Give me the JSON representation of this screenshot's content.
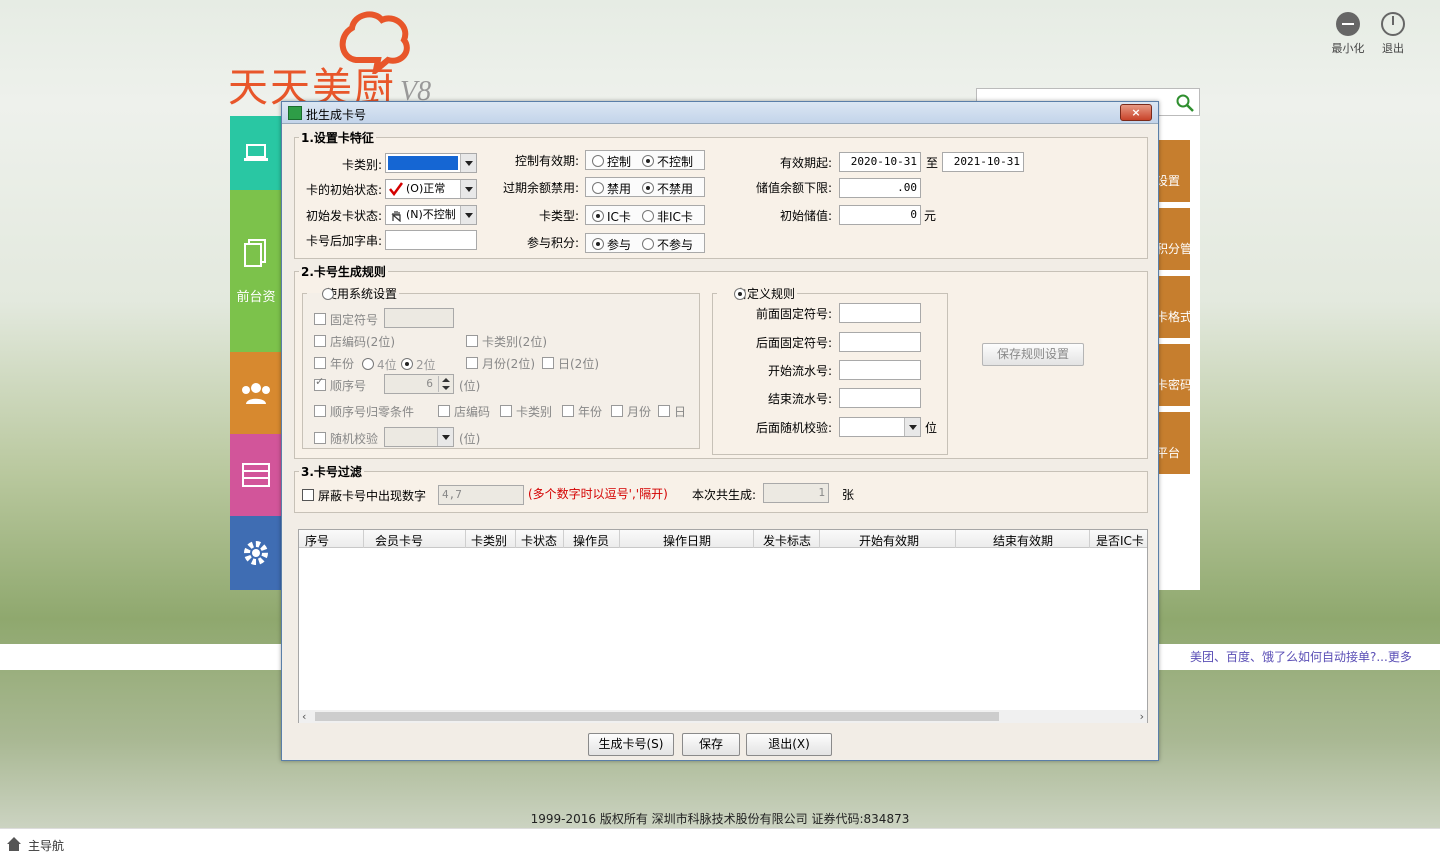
{
  "app": {
    "logo_text": "天天美厨",
    "logo_version": "V8",
    "minimize_label": "最小化",
    "exit_label": "退出",
    "front_label": "前台资",
    "right_tiles": [
      "设置",
      "积分管",
      "卡格式",
      "卡密码",
      "平台"
    ],
    "news_text": "美团、百度、饿了么如何自动接单?...更多",
    "copyright": "1999-2016  版权所有  深圳市科脉技术股份有限公司  证券代码:834873",
    "nav_label": "主导航"
  },
  "dialog": {
    "title": "批生成卡号",
    "close": "×",
    "sec1": {
      "legend": "1.设置卡特征",
      "card_type_label": "卡类别:",
      "init_status_label": "卡的初始状态:",
      "init_status_value": "(O)正常",
      "issue_status_label": "初始发卡状态:",
      "issue_status_value": "(N)不控制",
      "suffix_label": "卡号后加字串:",
      "validity_ctrl_label": "控制有效期:",
      "opt_control": "控制",
      "opt_no_control": "不控制",
      "expired_label": "过期余额禁用:",
      "opt_disable": "禁用",
      "opt_no_disable": "不禁用",
      "card_kind_label": "卡类型:",
      "opt_ic": "IC卡",
      "opt_non_ic": "非IC卡",
      "points_label": "参与积分:",
      "opt_join": "参与",
      "opt_no_join": "不参与",
      "valid_from_label": "有效期起:",
      "valid_from": "2020-10-31",
      "to_label": "至",
      "valid_to": "2021-10-31",
      "balance_min_label": "储值余额下限:",
      "balance_min": ".00",
      "init_value_label": "初始储值:",
      "init_value": "0",
      "yuan": "元"
    },
    "sec2": {
      "legend": "2.卡号生成规则",
      "sys_legend": "使用系统设置",
      "fixed_char": "固定符号",
      "store_code": "店编码(2位)",
      "card_cat": "卡类别(2位)",
      "year": "年份",
      "four": "4位",
      "two": "2位",
      "month": "月份(2位)",
      "day": "日(2位)",
      "seq": "顺序号",
      "seq_value": "6",
      "wei": "(位)",
      "seq_reset": "顺序号归零条件",
      "r_store": "店编码",
      "r_card": "卡类别",
      "r_year": "年份",
      "r_month": "月份",
      "r_day": "日",
      "random": "随机校验",
      "custom_legend": "自定义规则",
      "prefix_label": "前面固定符号:",
      "postfix_label": "后面固定符号:",
      "start_label": "开始流水号:",
      "end_label": "结束流水号:",
      "rand_label": "后面随机校验:",
      "wei2": "位",
      "save_rule": "保存规则设置"
    },
    "sec3": {
      "legend": "3.卡号过滤",
      "mask_label": "屏蔽卡号中出现数字",
      "mask_value": "4,7",
      "hint": "(多个数字时以逗号','隔开)",
      "total_label": "本次共生成:",
      "total_value": "1",
      "unit": "张"
    },
    "grid": {
      "columns": [
        "序号",
        "会员卡号",
        "卡类别",
        "卡状态",
        "操作员",
        "操作日期",
        "发卡标志",
        "开始有效期",
        "结束有效期",
        "是否IC卡"
      ]
    },
    "buttons": {
      "generate": "生成卡号(S)",
      "save": "保存",
      "exit": "退出(X)"
    }
  }
}
